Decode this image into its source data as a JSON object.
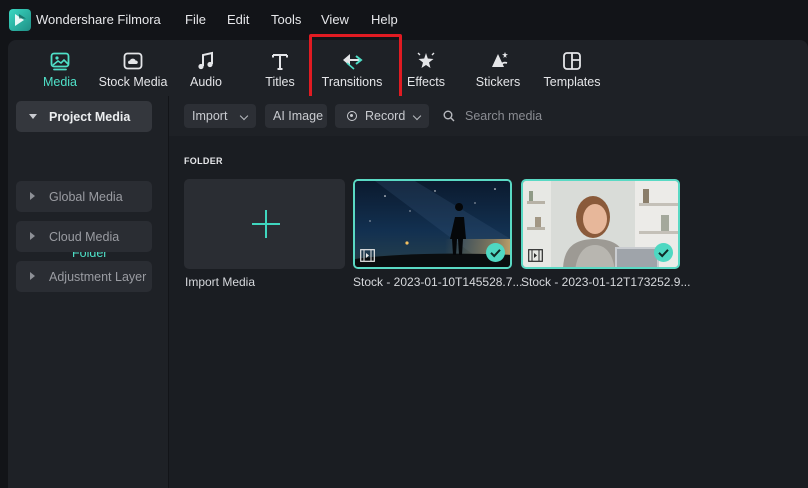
{
  "app": {
    "title": "Wondershare Filmora"
  },
  "menu": [
    "File",
    "Edit",
    "Tools",
    "View",
    "Help"
  ],
  "toolbar": {
    "items": [
      {
        "label": "Media",
        "icon": "media-icon",
        "active": true
      },
      {
        "label": "Stock Media",
        "icon": "stock-media-icon",
        "active": false
      },
      {
        "label": "Audio",
        "icon": "music-note-icon",
        "active": false
      },
      {
        "label": "Titles",
        "icon": "text-t-icon",
        "active": false
      },
      {
        "label": "Transitions",
        "icon": "transitions-arrows-icon",
        "active": false
      },
      {
        "label": "Effects",
        "icon": "effects-sparkle-icon",
        "active": false
      },
      {
        "label": "Stickers",
        "icon": "stickers-icon",
        "active": false
      },
      {
        "label": "Templates",
        "icon": "templates-icon",
        "active": false
      }
    ],
    "highlighted": "Transitions"
  },
  "sidebar": {
    "items": [
      {
        "label": "Project Media",
        "expanded": true
      },
      {
        "label": "Global Media",
        "expanded": false
      },
      {
        "label": "Cloud Media",
        "expanded": false
      },
      {
        "label": "Adjustment Layer",
        "expanded": false
      }
    ],
    "folder_label": "Folder"
  },
  "filterbar": {
    "import_label": "Import",
    "ai_image_label": "AI Image",
    "record_label": "Record",
    "search_placeholder": "Search media"
  },
  "content": {
    "section_label": "FOLDER",
    "import_caption": "Import Media",
    "clips": [
      {
        "name": "Stock - 2023-01-10T145528.7..."
      },
      {
        "name": "Stock - 2023-01-12T173252.9..."
      }
    ]
  },
  "colors": {
    "accent": "#4fe0c8",
    "highlight_box": "#e11b22",
    "panel": "#1e2126",
    "background": "#121418"
  }
}
